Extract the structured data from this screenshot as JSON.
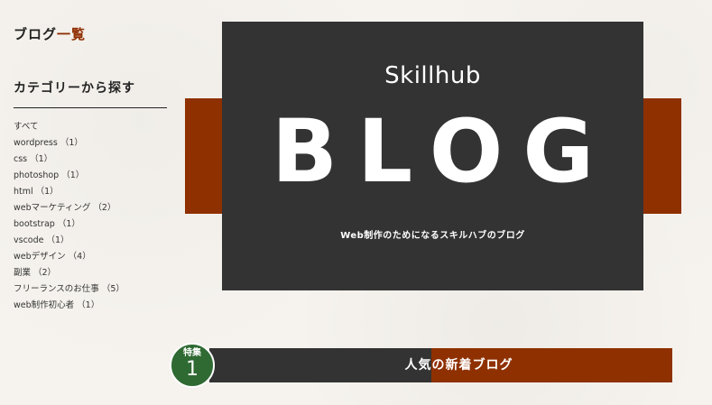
{
  "sidebar": {
    "heading_main": "ブログ",
    "heading_accent": "一覧",
    "category_title": "カテゴリーから探す",
    "categories": [
      {
        "label": "すべて",
        "count": ""
      },
      {
        "label": "wordpress",
        "count": "（1）"
      },
      {
        "label": "css",
        "count": "（1）"
      },
      {
        "label": "photoshop",
        "count": "（1）"
      },
      {
        "label": "html",
        "count": "（1）"
      },
      {
        "label": "webマーケティング",
        "count": "（2）"
      },
      {
        "label": "bootstrap",
        "count": "（1）"
      },
      {
        "label": "vscode",
        "count": "（1）"
      },
      {
        "label": "webデザイン",
        "count": "（4）"
      },
      {
        "label": "副業",
        "count": "（2）"
      },
      {
        "label": "フリーランスのお仕事",
        "count": "（5）"
      },
      {
        "label": "web制作初心者",
        "count": "（1）"
      }
    ]
  },
  "hero": {
    "brand": "Skillhub",
    "title": "BLOG",
    "tagline": "Web制作のためになるスキルハブのブログ"
  },
  "feature": {
    "badge_label": "特集",
    "badge_number": "1",
    "title": "人気の新着ブログ"
  },
  "colors": {
    "accent": "#8f3000",
    "dark": "#333333",
    "badge_green": "#2f6a32",
    "background": "#f6f3ee"
  }
}
